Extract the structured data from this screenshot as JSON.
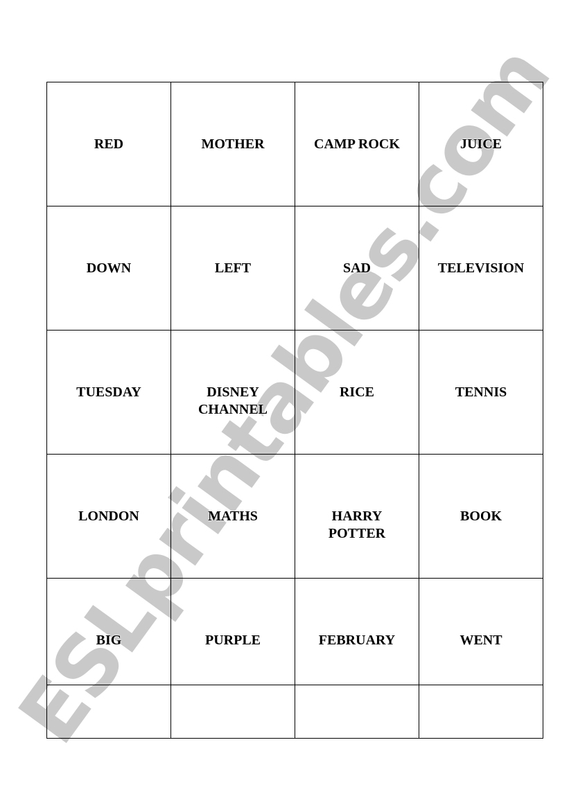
{
  "watermark": "ESLprintables.com",
  "grid": {
    "rows": [
      [
        "RED",
        "MOTHER",
        "CAMP ROCK",
        "JUICE"
      ],
      [
        "DOWN",
        "LEFT",
        "SAD",
        "TELEVISION"
      ],
      [
        "TUESDAY",
        "DISNEY CHANNEL",
        "RICE",
        "TENNIS"
      ],
      [
        "LONDON",
        "MATHS",
        "HARRY POTTER",
        "BOOK"
      ],
      [
        "BIG",
        "PURPLE",
        "FEBRUARY",
        "WENT"
      ],
      [
        "",
        "",
        "",
        ""
      ]
    ]
  }
}
